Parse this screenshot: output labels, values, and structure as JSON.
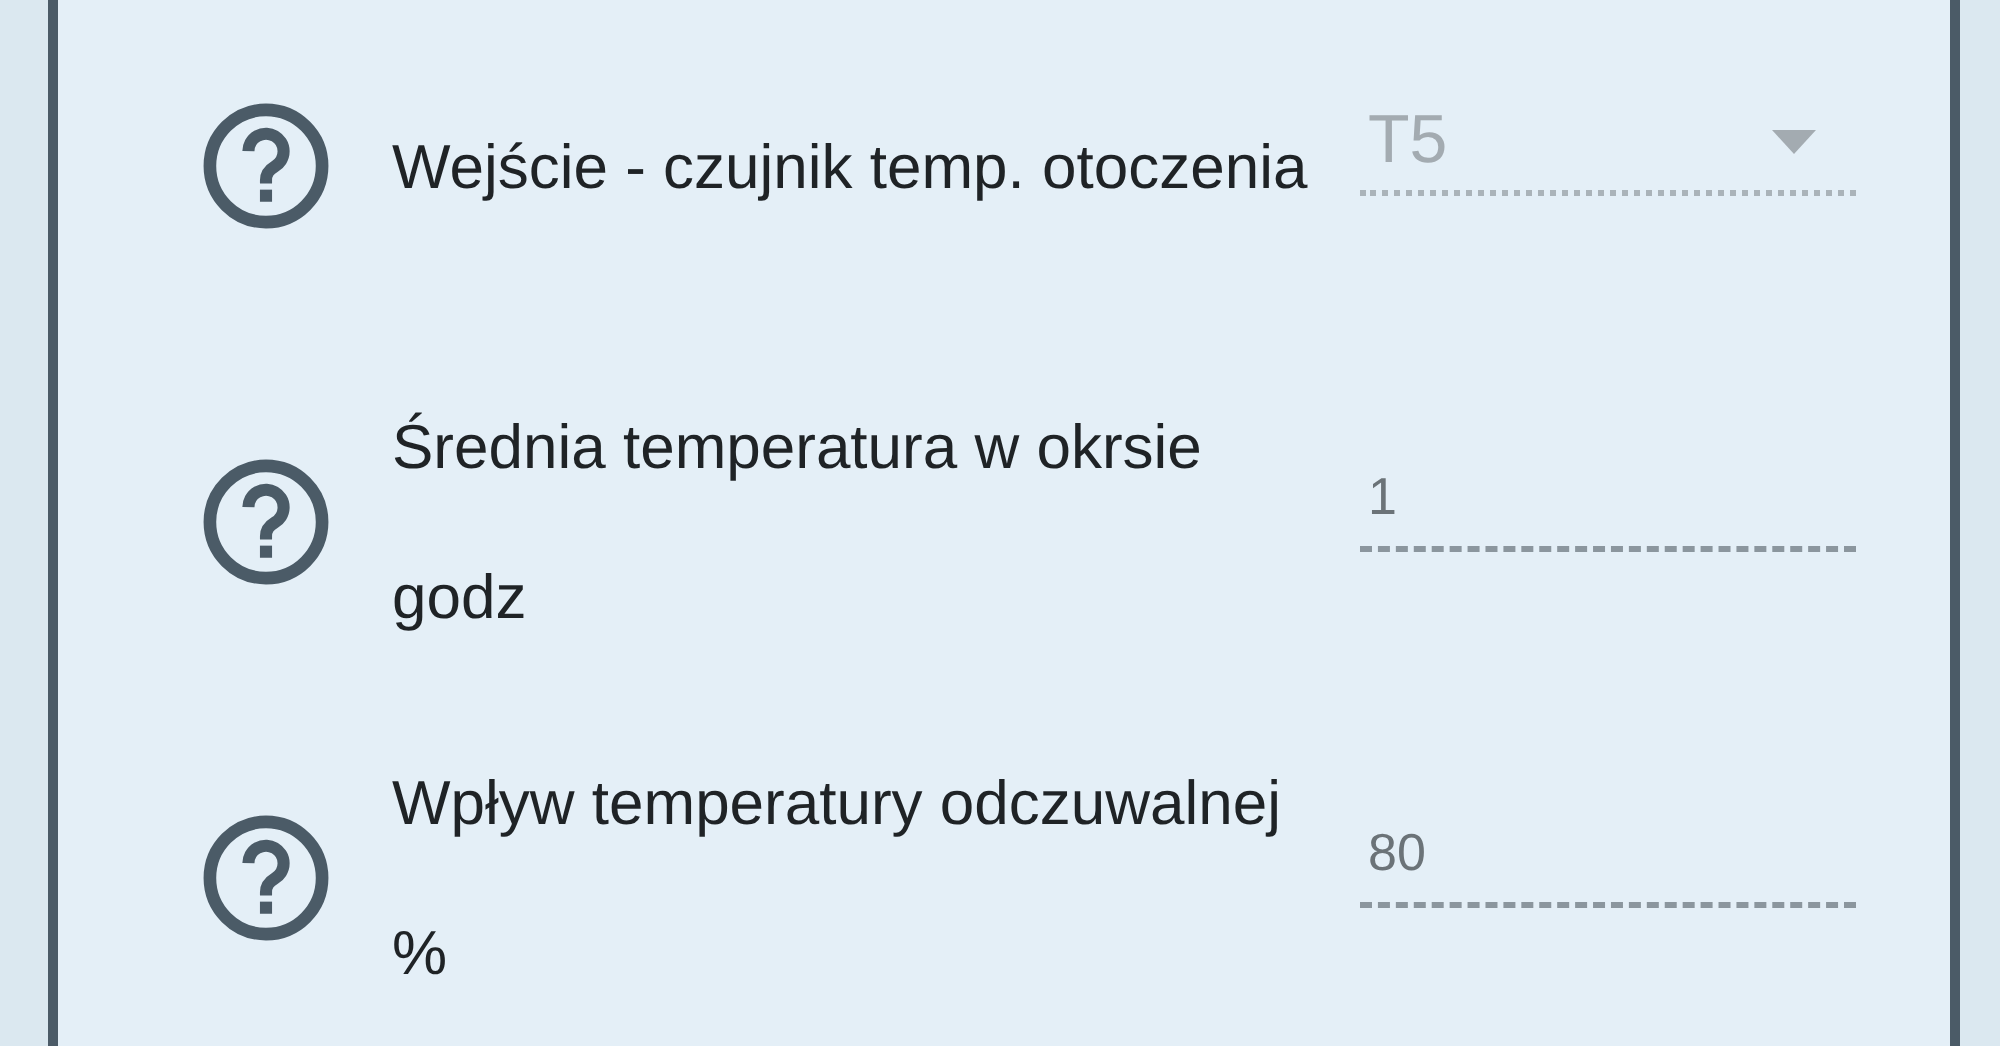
{
  "settings": [
    {
      "label": "Wejście - czujnik temp. otoczenia",
      "field": {
        "kind": "select",
        "value": "T5",
        "disabled": true
      }
    },
    {
      "label": "Średnia temperatura w okrsie godz",
      "field": {
        "kind": "input",
        "value": "1",
        "disabled": false
      }
    },
    {
      "label": "Wpływ temperatury odczuwalnej %",
      "field": {
        "kind": "input",
        "value": "80",
        "disabled": false
      }
    }
  ]
}
